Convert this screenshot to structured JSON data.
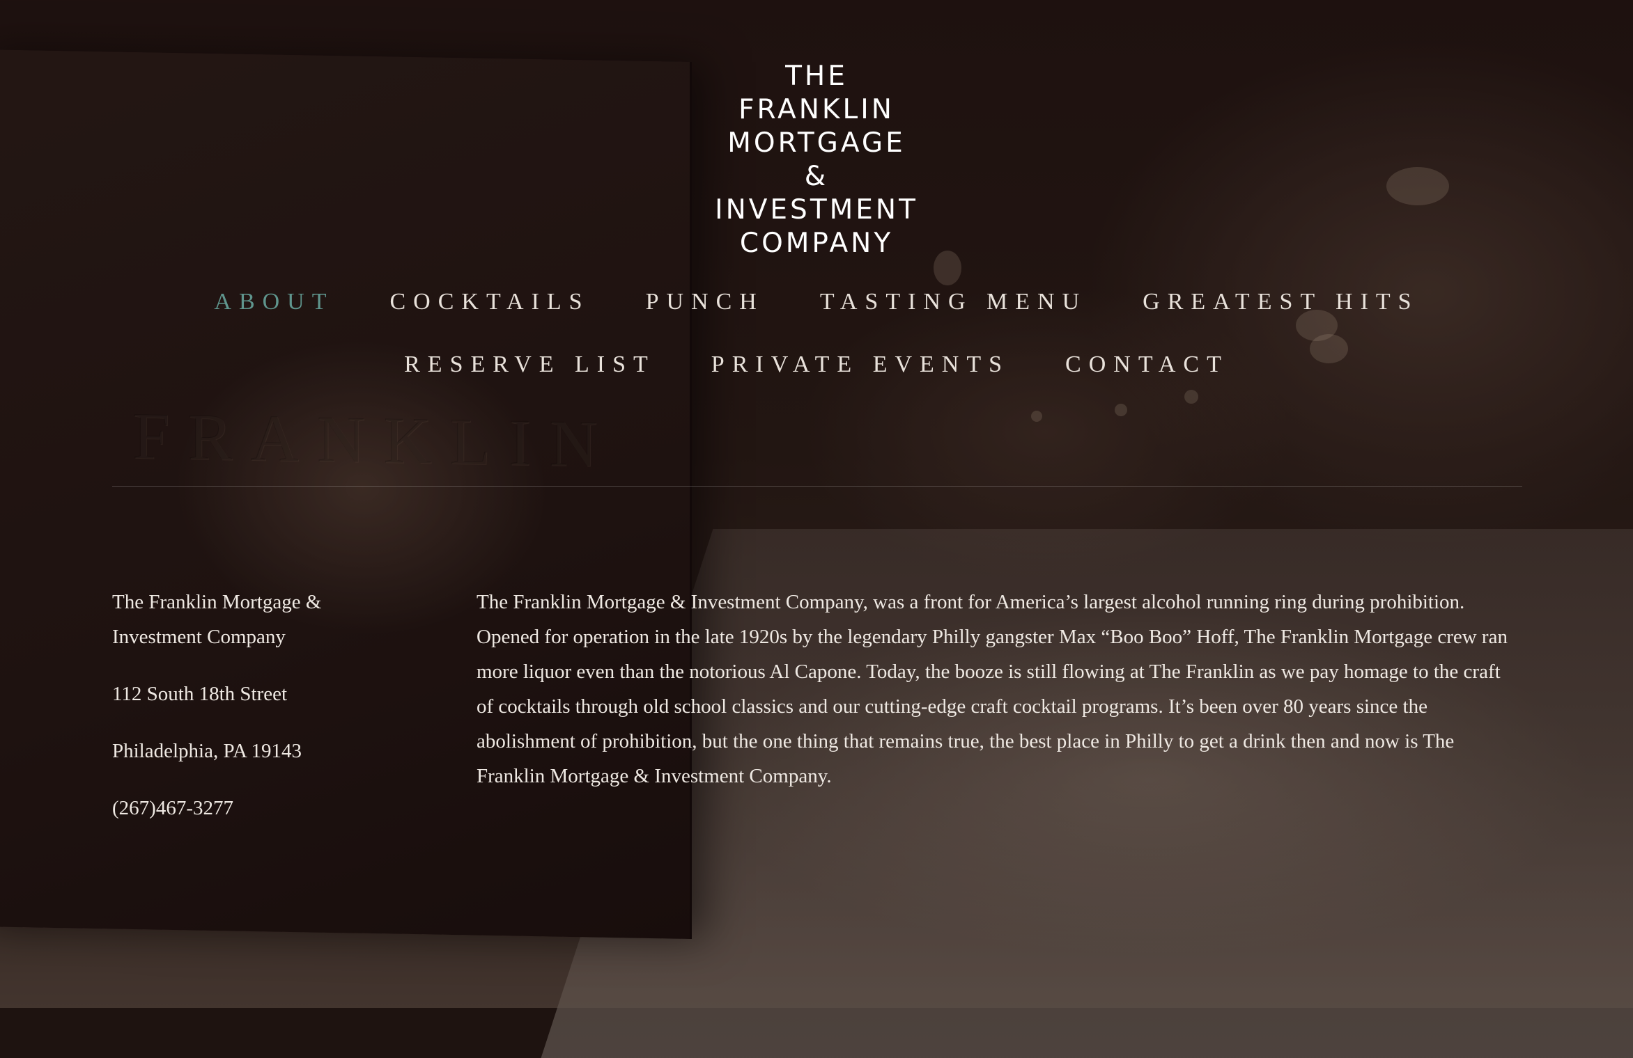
{
  "logo": {
    "lines": [
      "THE",
      "FRANKLIN",
      "MORTGAGE",
      "&",
      "INVESTMENT",
      "COMPANY"
    ]
  },
  "nav": {
    "row1": [
      "ABOUT",
      "COCKTAILS",
      "PUNCH",
      "TASTING MENU",
      "GREATEST HITS"
    ],
    "row2": [
      "RESERVE LIST",
      "PRIVATE EVENTS",
      "CONTACT"
    ],
    "active": "ABOUT",
    "active_color": "#5f958d"
  },
  "address": {
    "name_line1": "The Franklin Mortgage &",
    "name_line2": "Investment Company",
    "street": "112 South 18th Street",
    "city": "Philadelphia, PA 19143",
    "phone": "(267)467-3277"
  },
  "about": {
    "text": "The Franklin Mortgage & Investment Company, was a front for America’s largest alcohol running ring during prohibition. Opened for operation in the late 1920s by the legendary Philly gangster Max “Boo Boo” Hoff, The Franklin Mortgage crew ran more liquor even than the notorious Al Capone. Today, the booze is still flowing at The Franklin as we pay homage to the craft of cocktails through old school classics and our cutting-edge craft cocktail programs. It’s been over 80 years since the abolishment of prohibition, but the one thing that remains true, the best place in Philly to get a drink then and now is The Franklin Mortgage & Investment Company."
  },
  "background": {
    "embossed_text": "FRANKLIN"
  }
}
